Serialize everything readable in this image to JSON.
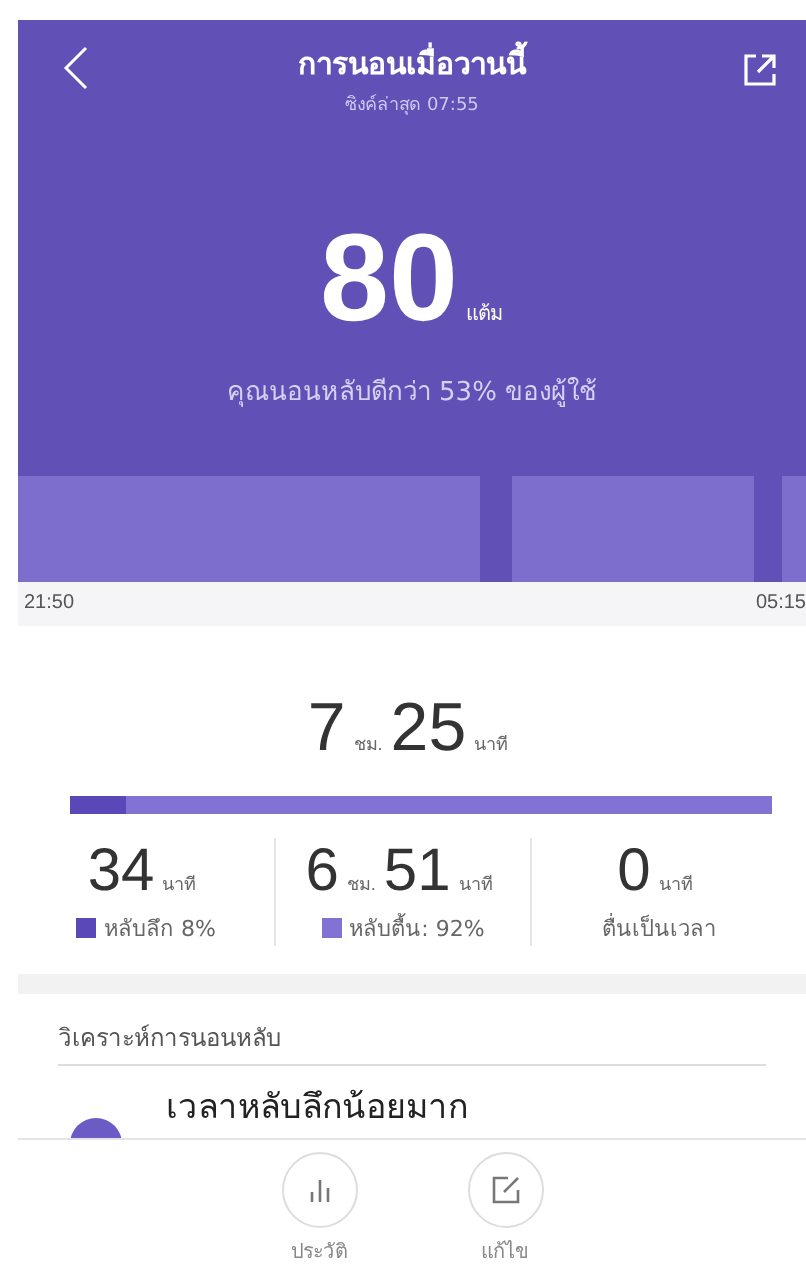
{
  "header": {
    "title": "การนอนเมื่อวานนี้",
    "subtitle": "ซิงค์ล่าสุด 07:55",
    "score": "80",
    "score_unit": "แต้ม",
    "comparison": "คุณนอนหลับดีกว่า 53% ของผู้ใช้"
  },
  "timeline": {
    "start": "21:50",
    "end": "05:15"
  },
  "total": {
    "hours": "7",
    "hours_unit": "ชม.",
    "minutes": "25",
    "minutes_unit": "นาที"
  },
  "ratio_bar": {
    "level": 0.08
  },
  "stats": [
    {
      "kind": "legend",
      "minutes": "34",
      "minutes_unit": "นาที",
      "label": "หลับลึก 8%",
      "color": "#5b48b8"
    },
    {
      "kind": "legend",
      "hours": "6",
      "hours_unit": "ชม.",
      "minutes": "51",
      "minutes_unit": "นาที",
      "label": "หลับตื้น: 92%",
      "color": "#8272d4"
    },
    {
      "kind": "plain",
      "minutes": "0",
      "minutes_unit": "นาที",
      "label": "ตื่นเป็นเวลา"
    }
  ],
  "analysis": {
    "title": "วิเคราะห์การนอนหลับ",
    "item_title": "เวลาหลับลึกน้อยมาก"
  },
  "bottom_bar": [
    {
      "kind": "history",
      "label": "ประวัติ"
    },
    {
      "kind": "edit",
      "label": "แก้ไข"
    }
  ]
}
